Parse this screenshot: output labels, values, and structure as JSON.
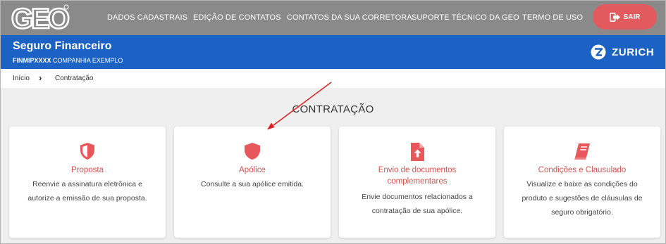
{
  "header": {
    "logo": "GEO",
    "nav": [
      "DADOS CADASTRAIS",
      "EDIÇÃO DE CONTATOS",
      "CONTATOS DA SUA CORRETORA",
      "SUPORTE TÉCNICO DA GEO",
      "TERMO DE USO"
    ],
    "logout_label": "SAIR"
  },
  "band": {
    "title": "Seguro Financeiro",
    "code": "FINMIPXXXX",
    "company": "COMPANHIA EXEMPLO",
    "brand": "ZURICH"
  },
  "breadcrumb": {
    "home": "Início",
    "separator": "›",
    "current": "Contratação"
  },
  "page_title": "CONTRATAÇÃO",
  "cards": [
    {
      "icon": "shield-half-icon",
      "title": "Proposta",
      "desc": [
        "Reenvie a assinatura eletrônica e",
        "autorize a emissão de sua proposta."
      ]
    },
    {
      "icon": "shield-icon",
      "title": "Apólice",
      "desc": [
        "Consulte a sua apólice emitida."
      ]
    },
    {
      "icon": "file-upload-icon",
      "title_lines": [
        "Envio de documentos",
        "complementares"
      ],
      "desc": [
        "Envie documentos relacionados a",
        "contratação de sua apólice."
      ]
    },
    {
      "icon": "book-icon",
      "title": "Condições e Clausulado",
      "desc": [
        "Visualize e baixe as condições do",
        "produto e sugestões de cláusulas de",
        "seguro obrigatório."
      ]
    }
  ],
  "colors": {
    "topbar": "#8a8a8a",
    "band": "#1c62c4",
    "accent": "#e35a5e",
    "icon": "#e8575a",
    "annotation_arrow": "#e02020"
  }
}
